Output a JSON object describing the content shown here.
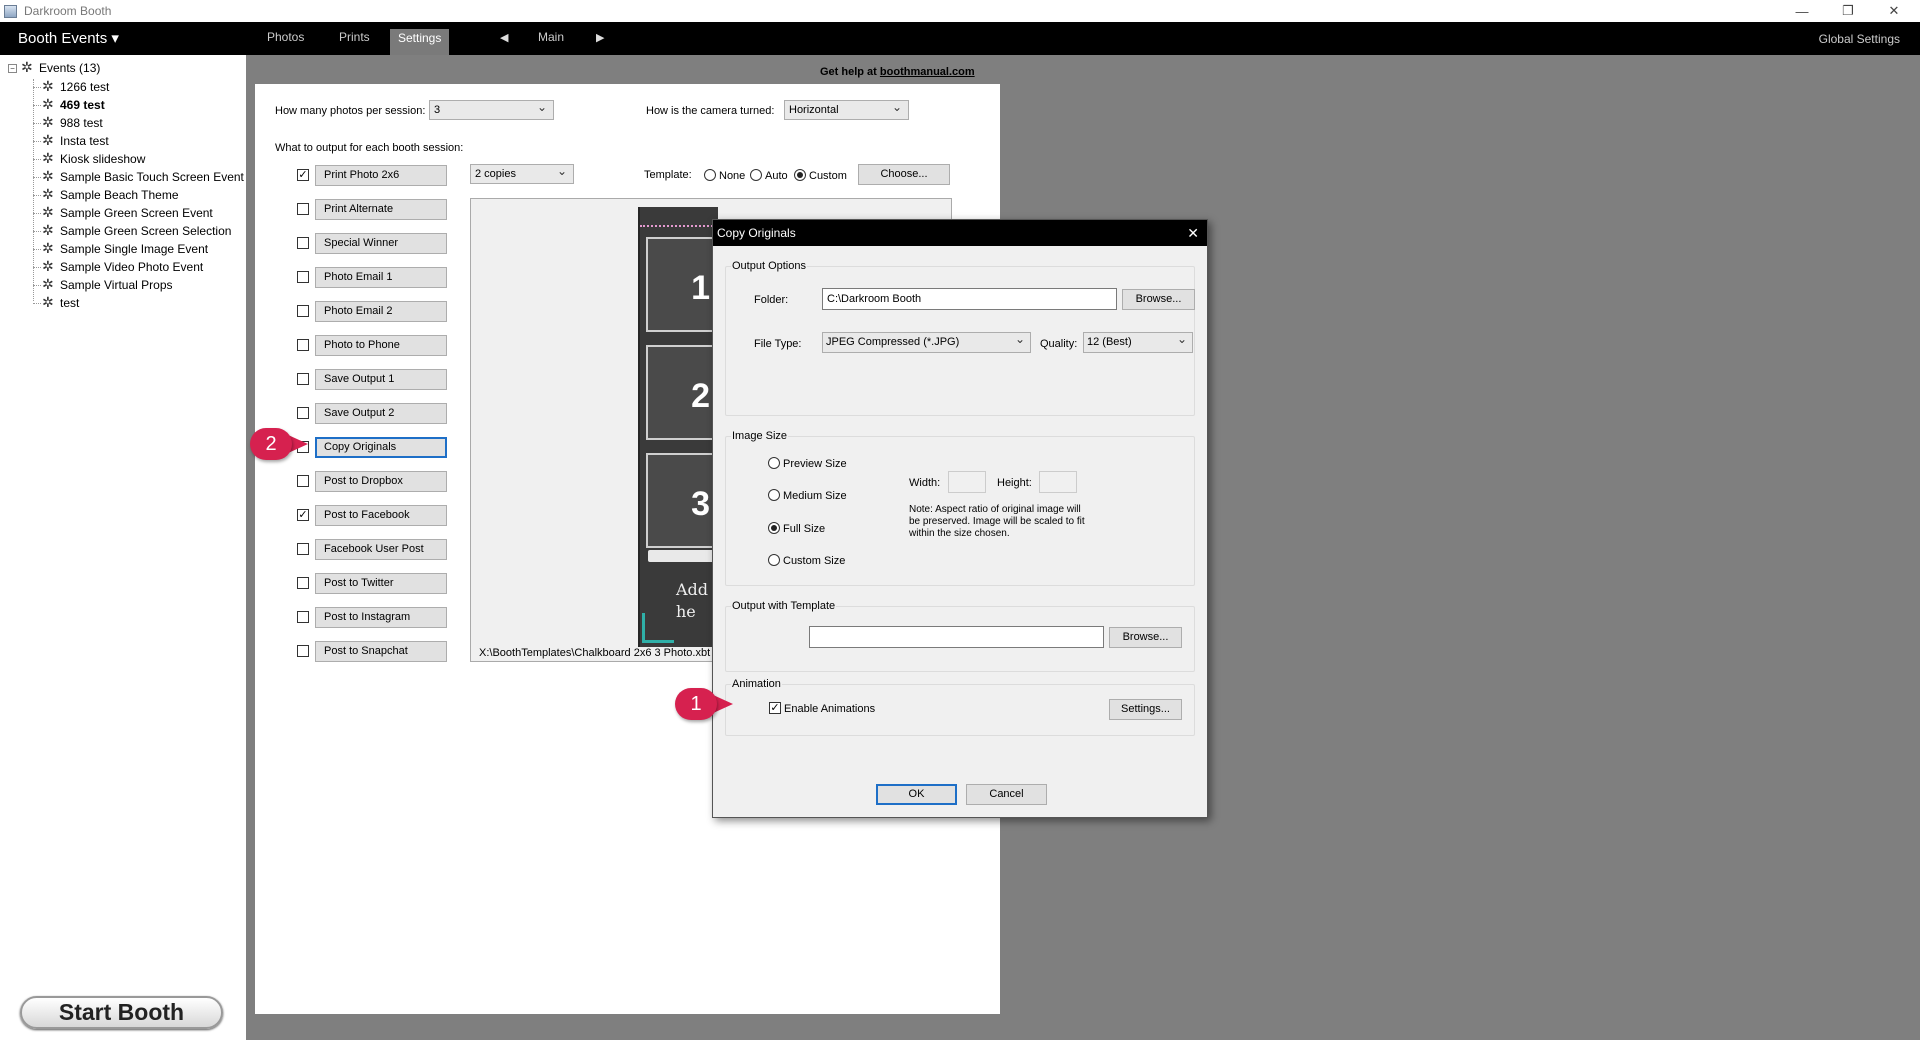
{
  "window": {
    "title": "Darkroom Booth"
  },
  "menubar": {
    "booth_events": "Booth Events ▾",
    "tabs": [
      "Photos",
      "Prints",
      "Settings"
    ],
    "main_label": "Main",
    "global_settings": "Global Settings"
  },
  "tree": {
    "root": "Events (13)",
    "items": [
      "1266 test",
      "469 test",
      "988 test",
      "Insta test",
      "Kiosk slideshow",
      "Sample Basic Touch Screen Event",
      "Sample Beach Theme",
      "Sample Green Screen Event",
      "Sample Green Screen Selection",
      "Sample Single Image Event",
      "Sample Video Photo Event",
      "Sample Virtual Props",
      "test"
    ]
  },
  "start_booth": "Start Booth",
  "help": {
    "prefix": "Get help at ",
    "link": "boothmanual.com"
  },
  "settings": {
    "photos_label": "How many photos per session:",
    "photos_value": "3",
    "camera_label": "How is the camera turned:",
    "camera_value": "Horizontal",
    "output_label": "What to output for each booth session:",
    "copies_value": "2 copies",
    "template_label": "Template:",
    "template_none": "None",
    "template_auto": "Auto",
    "template_custom": "Custom",
    "choose_label": "Choose...",
    "template_path": "X:\\BoothTemplates\\Chalkboard 2x6 3 Photo.xbt",
    "outputs": [
      {
        "label": "Print Photo  2x6",
        "checked": true
      },
      {
        "label": "Print Alternate",
        "checked": false
      },
      {
        "label": "Special Winner",
        "checked": false
      },
      {
        "label": "Photo Email 1",
        "checked": false
      },
      {
        "label": "Photo Email 2",
        "checked": false
      },
      {
        "label": "Photo to Phone",
        "checked": false
      },
      {
        "label": "Save Output 1",
        "checked": false
      },
      {
        "label": "Save Output 2",
        "checked": false
      },
      {
        "label": "Copy Originals",
        "checked": false
      },
      {
        "label": "Post to Dropbox",
        "checked": false
      },
      {
        "label": "Post to Facebook",
        "checked": true
      },
      {
        "label": "Facebook User Post",
        "checked": false
      },
      {
        "label": "Post to Twitter",
        "checked": false
      },
      {
        "label": "Post to Instagram",
        "checked": false
      },
      {
        "label": "Post to Snapchat",
        "checked": false
      }
    ]
  },
  "preview": {
    "numbers": [
      "1",
      "2",
      "3"
    ],
    "text": "Add\nhe"
  },
  "dialog": {
    "title": "Copy Originals",
    "output_options": "Output Options",
    "folder_label": "Folder:",
    "folder_value": "C:\\Darkroom Booth",
    "browse": "Browse...",
    "filetype_label": "File Type:",
    "filetype_value": "JPEG Compressed (*.JPG)",
    "quality_label": "Quality:",
    "quality_value": "12 (Best)",
    "image_size": "Image Size",
    "size_preview": "Preview Size",
    "size_medium": "Medium Size",
    "size_full": "Full Size",
    "size_custom": "Custom Size",
    "width_label": "Width:",
    "height_label": "Height:",
    "note": "Note: Aspect ratio of original image will be preserved. Image will be scaled to fit within the size chosen.",
    "output_template": "Output with Template",
    "template_value": "",
    "animation": "Animation",
    "enable_animations": "Enable Animations",
    "settings_btn": "Settings...",
    "ok": "OK",
    "cancel": "Cancel"
  },
  "callouts": [
    "1",
    "2"
  ]
}
